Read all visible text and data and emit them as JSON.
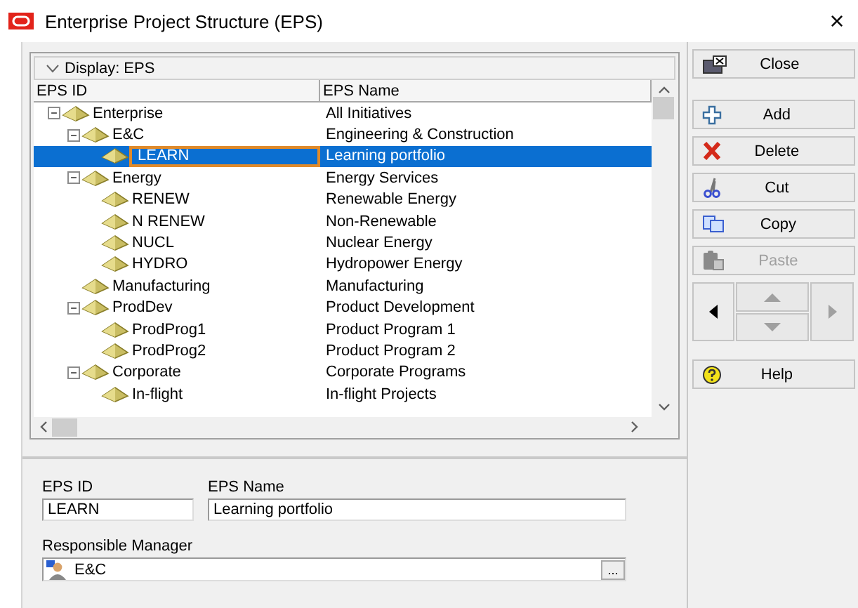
{
  "window": {
    "title": "Enterprise Project Structure (EPS)",
    "close": "×"
  },
  "tree": {
    "display_label": "Display: EPS",
    "columns": [
      "EPS ID",
      "EPS Name"
    ],
    "rows": [
      {
        "id": "Enterprise",
        "name": "All  Initiatives",
        "expanded": true,
        "selected": false,
        "children": [
          {
            "id": "E&C",
            "name": "Engineering & Construction",
            "expanded": true,
            "selected": false,
            "children": [
              {
                "id": "LEARN",
                "name": "Learning portfolio",
                "selected": true
              }
            ]
          },
          {
            "id": "Energy",
            "name": "Energy Services",
            "expanded": true,
            "selected": false,
            "children": [
              {
                "id": "RENEW",
                "name": "Renewable Energy",
                "selected": false
              },
              {
                "id": "N RENEW",
                "name": "Non-Renewable",
                "selected": false
              },
              {
                "id": "NUCL",
                "name": "Nuclear Energy",
                "selected": false
              },
              {
                "id": "HYDRO",
                "name": "Hydropower Energy",
                "selected": false
              }
            ]
          },
          {
            "id": "Manufacturing",
            "name": "Manufacturing",
            "selected": false
          },
          {
            "id": "ProdDev",
            "name": "Product Development",
            "expanded": true,
            "selected": false,
            "children": [
              {
                "id": "ProdProg1",
                "name": "Product Program 1",
                "selected": false
              },
              {
                "id": "ProdProg2",
                "name": "Product Program 2",
                "selected": false
              }
            ]
          },
          {
            "id": "Corporate",
            "name": "Corporate Programs",
            "expanded": true,
            "selected": false,
            "children": [
              {
                "id": "In-flight",
                "name": "In-flight Projects",
                "selected": false
              }
            ]
          }
        ]
      }
    ]
  },
  "form": {
    "eps_id_label": "EPS ID",
    "eps_id": "LEARN",
    "eps_name_label": "EPS Name",
    "eps_name": "Learning portfolio",
    "manager_label": "Responsible Manager",
    "manager": "E&C",
    "browse": "..."
  },
  "buttons": [
    {
      "kind": "close",
      "label": "Close",
      "disabled": false
    },
    {
      "kind": "add",
      "label": "Add",
      "disabled": false
    },
    {
      "kind": "delete",
      "label": "Delete",
      "disabled": false
    },
    {
      "kind": "cut",
      "label": "Cut",
      "disabled": false
    },
    {
      "kind": "copy",
      "label": "Copy",
      "disabled": false
    },
    {
      "kind": "paste",
      "label": "Paste",
      "disabled": true
    }
  ],
  "nav": [
    {
      "kind": "left",
      "disabled": false
    },
    {
      "kind": "up",
      "disabled": true
    },
    {
      "kind": "down",
      "disabled": true
    },
    {
      "kind": "right",
      "disabled": true
    }
  ],
  "help": {
    "label": "Help"
  }
}
